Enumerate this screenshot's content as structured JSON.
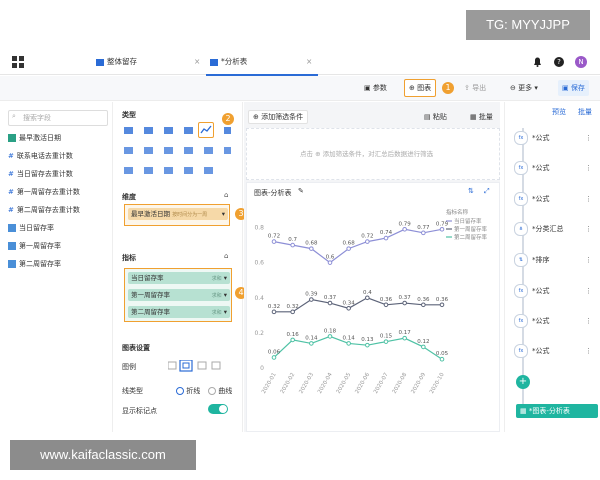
{
  "watermarks": {
    "top": "TG: MYYJJPP",
    "bottom": "www.kaifaclassic.com"
  },
  "tabs": [
    {
      "label": "整体留存"
    },
    {
      "label": "*分析表"
    }
  ],
  "toolbar": {
    "params": "参数",
    "chart": "图表",
    "export": "导出",
    "more": "更多",
    "save": "保存"
  },
  "right_header": {
    "preview": "预览",
    "batch": "批量"
  },
  "left": {
    "search_placeholder": "搜索字段",
    "fields": [
      "最早激活日期",
      "联系电话去重计数",
      "当日留存去重计数",
      "第一周留存去重计数",
      "第二周留存去重计数",
      "当日留存率",
      "第一周留存率",
      "第二周留存率"
    ]
  },
  "mid": {
    "type_title": "类型",
    "dimension_title": "维度",
    "dimension_chip": "最早激活日期",
    "dimension_chip_hint": "按时间分为一周",
    "metric_title": "指标",
    "metrics": [
      {
        "label": "当日留存率",
        "agg": "求和"
      },
      {
        "label": "第一周留存率",
        "agg": "求和"
      },
      {
        "label": "第二周留存率",
        "agg": "求和"
      }
    ],
    "chart_settings_title": "图表设置",
    "legend_label": "图例",
    "linetype_label": "线类型",
    "line_fold": "折线",
    "line_curve": "曲线",
    "show_markers": "显示标记点"
  },
  "filter": {
    "add": "添加筛选条件",
    "paste": "粘贴",
    "batch": "批量",
    "hint": "点击 ⊕ 添加筛选条件，对汇总后数据进行筛选"
  },
  "callouts": [
    "1",
    "2",
    "3",
    "4"
  ],
  "chart_data": {
    "type": "line",
    "title": "图表-分析表",
    "categories": [
      "2020-01",
      "2020-02",
      "2020-03",
      "2020-04",
      "2020-05",
      "2020-06",
      "2020-07",
      "2020-08",
      "2020-09",
      "2020-10"
    ],
    "legend_title": "指标名称",
    "legend_position": "top-right",
    "y_ticks": [
      0.8,
      0.6,
      0.4,
      0.2,
      0
    ],
    "ylim": [
      0,
      0.9
    ],
    "grid": false,
    "series": [
      {
        "name": "当日留存率",
        "color": "#8d8fd6",
        "values": [
          0.72,
          0.7,
          0.68,
          0.6,
          0.68,
          0.72,
          0.74,
          0.79,
          0.77,
          0.79
        ]
      },
      {
        "name": "第一周留存率",
        "color": "#5c6378",
        "values": [
          0.32,
          0.32,
          0.39,
          0.37,
          0.34,
          0.4,
          0.36,
          0.37,
          0.36,
          0.36
        ]
      },
      {
        "name": "第二周留存率",
        "color": "#4fc2a5",
        "values": [
          0.06,
          0.16,
          0.14,
          0.18,
          0.14,
          0.13,
          0.15,
          0.17,
          0.12,
          0.05
        ]
      }
    ]
  },
  "right_items": [
    {
      "label": "*公式",
      "icon": "fx"
    },
    {
      "label": "*公式",
      "icon": "fx"
    },
    {
      "label": "*公式",
      "icon": "fx"
    },
    {
      "label": "*分类汇总",
      "icon": "group"
    },
    {
      "label": "*排序",
      "icon": "sort"
    },
    {
      "label": "*公式",
      "icon": "fx"
    },
    {
      "label": "*公式",
      "icon": "fx"
    },
    {
      "label": "*公式",
      "icon": "fx"
    }
  ],
  "right_footer": "*图表-分析表",
  "colors": {
    "accent": "#2a6bd6",
    "callout": "#f0a030",
    "teal": "#1fb5a0"
  }
}
